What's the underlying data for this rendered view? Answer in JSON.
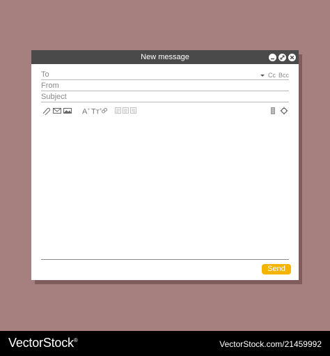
{
  "window": {
    "title": "New message"
  },
  "titlebar_controls": [
    {
      "name": "minimize-icon"
    },
    {
      "name": "expand-icon"
    },
    {
      "name": "close-icon"
    }
  ],
  "fields": {
    "to_label": "To",
    "from_label": "From",
    "subject_label": "Subject",
    "cc_label": "Cc",
    "bcc_label": "Bcc"
  },
  "toolbar": {
    "icons": [
      "attachment-icon",
      "envelope-icon",
      "image-icon",
      "font-size-icon",
      "text-format-icon",
      "link-icon",
      "align-left-icon",
      "align-center-icon",
      "align-right-icon",
      "trash-icon",
      "settings-icon"
    ],
    "font_size_glyph": "A",
    "text_format_glyph": "Tт"
  },
  "send_label": "Send",
  "colors": {
    "background": "#a5807f",
    "titlebar": "#4a4a4a",
    "send": "#f5b400"
  },
  "footer": {
    "brand": "VectorStock",
    "brand_mark": "®",
    "watermark": "VectorStock.com/21459992"
  }
}
